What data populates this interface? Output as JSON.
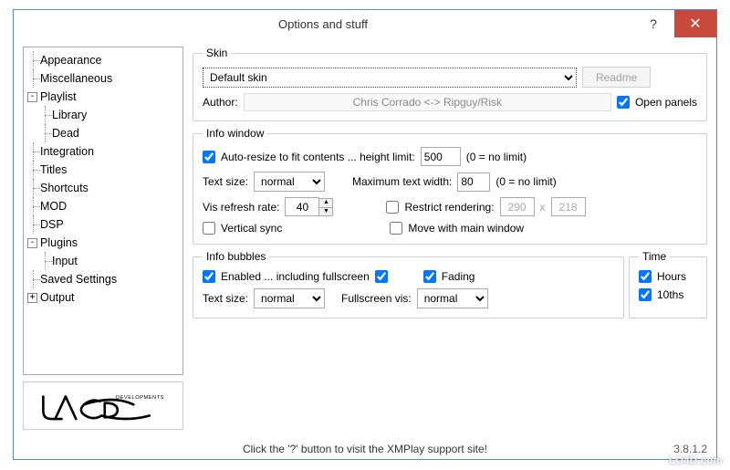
{
  "window": {
    "title": "Options and stuff"
  },
  "tree": {
    "items": [
      {
        "label": "Appearance",
        "child": false,
        "expander": ""
      },
      {
        "label": "Miscellaneous",
        "child": false,
        "expander": ""
      },
      {
        "label": "Playlist",
        "child": false,
        "expander": "-"
      },
      {
        "label": "Library",
        "child": true,
        "expander": ""
      },
      {
        "label": "Dead",
        "child": true,
        "expander": ""
      },
      {
        "label": "Integration",
        "child": false,
        "expander": ""
      },
      {
        "label": "Titles",
        "child": false,
        "expander": ""
      },
      {
        "label": "Shortcuts",
        "child": false,
        "expander": ""
      },
      {
        "label": "MOD",
        "child": false,
        "expander": ""
      },
      {
        "label": "DSP",
        "child": false,
        "expander": ""
      },
      {
        "label": "Plugins",
        "child": false,
        "expander": "-"
      },
      {
        "label": "Input",
        "child": true,
        "expander": ""
      },
      {
        "label": "Saved Settings",
        "child": false,
        "expander": ""
      },
      {
        "label": "Output",
        "child": false,
        "expander": "+"
      }
    ]
  },
  "skin": {
    "legend": "Skin",
    "selected": "Default skin",
    "readme": "Readme",
    "author_label": "Author:",
    "author": "Chris Corrado <-> Ripguy/Risk",
    "open_panels": "Open panels"
  },
  "info": {
    "legend": "Info window",
    "autoresize": "Auto-resize to fit contents ... height limit:",
    "height_limit": "500",
    "no_limit": "(0 = no limit)",
    "text_size_label": "Text size:",
    "text_size": "normal",
    "max_width_label": "Maximum text width:",
    "max_width": "80",
    "vis_label": "Vis refresh rate:",
    "vis_rate": "40",
    "restrict": "Restrict rendering:",
    "restrict_w": "290",
    "restrict_x": "x",
    "restrict_h": "218",
    "vsync": "Vertical sync",
    "move_with": "Move with main window"
  },
  "bubbles": {
    "legend": "Info bubbles",
    "enabled": "Enabled ... including fullscreen",
    "fading": "Fading",
    "text_size_label": "Text size:",
    "text_size": "normal",
    "fullscreen_label": "Fullscreen vis:",
    "fullscreen": "normal"
  },
  "time": {
    "legend": "Time",
    "hours": "Hours",
    "tenths": "10ths"
  },
  "footer": {
    "text": "Click the '?' button to visit the XMPlay support site!",
    "version": "3.8.1.2"
  },
  "watermark": "LO4D.com"
}
